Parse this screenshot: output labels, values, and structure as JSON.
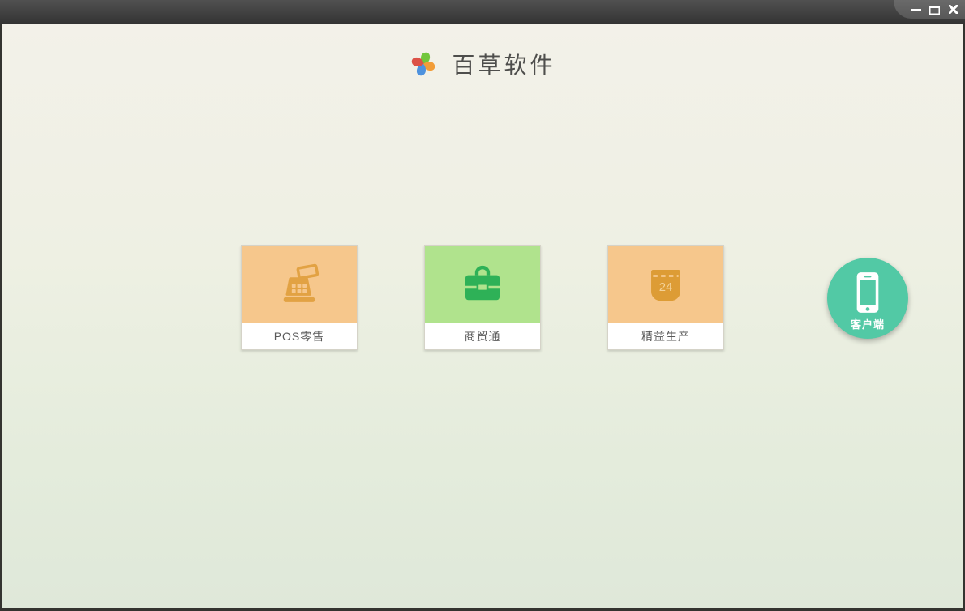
{
  "window": {
    "controls": [
      {
        "name": "minimize"
      },
      {
        "name": "maximize"
      },
      {
        "name": "close"
      }
    ]
  },
  "header": {
    "logo_icon": "pinwheel-logo",
    "logo_colors": {
      "top": "#72c63c",
      "right": "#f29d38",
      "bottom": "#4e92de",
      "left": "#dc5247"
    },
    "app_title": "百草软件"
  },
  "products": [
    {
      "label": "POS零售",
      "icon": "cash-register-icon",
      "tile_color": "#f6c78c",
      "icon_color": "#e2a243"
    },
    {
      "label": "商贸通",
      "icon": "briefcase-icon",
      "tile_color": "#b0e38d",
      "icon_color": "#2eb157"
    },
    {
      "label": "精益生产",
      "icon": "calendar-icon",
      "tile_color": "#f6c78c",
      "icon_color": "#dd9c35",
      "calendar_day": "24"
    }
  ],
  "client_button": {
    "label": "客户端",
    "icon": "smartphone-icon",
    "color": "#52c9a5"
  },
  "theme": {
    "titlebar_top": "#515151",
    "titlebar_bottom": "#333333",
    "background_top": "#f3f1e9",
    "background_bottom": "#dfe8d9",
    "label_text_color": "#595959"
  }
}
